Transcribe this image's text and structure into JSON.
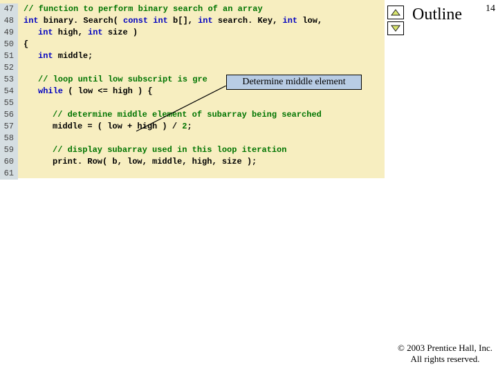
{
  "page_number": "14",
  "outline_title": "Outline",
  "callout_text": "Determine middle element",
  "footer_line1": "© 2003 Prentice Hall, Inc.",
  "footer_line2": "All rights reserved.",
  "code": {
    "lines": [
      {
        "n": "47",
        "indent": 0,
        "segs": [
          {
            "cls": "comment",
            "t": "// function to perform binary search of an array"
          }
        ]
      },
      {
        "n": "48",
        "indent": 0,
        "segs": [
          {
            "cls": "kw-blue",
            "t": "int"
          },
          {
            "cls": "code-text",
            "t": " binary. Search( "
          },
          {
            "cls": "kw-blue",
            "t": "const int"
          },
          {
            "cls": "code-text",
            "t": " b[], "
          },
          {
            "cls": "kw-blue",
            "t": "int"
          },
          {
            "cls": "code-text",
            "t": " search. Key, "
          },
          {
            "cls": "kw-blue",
            "t": "int"
          },
          {
            "cls": "code-text",
            "t": " low,"
          }
        ]
      },
      {
        "n": "49",
        "indent": 1,
        "segs": [
          {
            "cls": "kw-blue",
            "t": "int"
          },
          {
            "cls": "code-text",
            "t": " high, "
          },
          {
            "cls": "kw-blue",
            "t": "int"
          },
          {
            "cls": "code-text",
            "t": " size )"
          }
        ]
      },
      {
        "n": "50",
        "indent": 0,
        "segs": [
          {
            "cls": "code-text",
            "t": "{"
          }
        ]
      },
      {
        "n": "51",
        "indent": 1,
        "segs": [
          {
            "cls": "kw-blue",
            "t": "int"
          },
          {
            "cls": "code-text",
            "t": " middle;"
          }
        ]
      },
      {
        "n": "52",
        "indent": 0,
        "segs": []
      },
      {
        "n": "53",
        "indent": 1,
        "segs": [
          {
            "cls": "comment",
            "t": "// loop until low subscript is gre"
          }
        ]
      },
      {
        "n": "54",
        "indent": 1,
        "segs": [
          {
            "cls": "kw-blue",
            "t": "while"
          },
          {
            "cls": "code-text",
            "t": " ( low <= high ) {"
          }
        ]
      },
      {
        "n": "55",
        "indent": 0,
        "segs": []
      },
      {
        "n": "56",
        "indent": 2,
        "segs": [
          {
            "cls": "comment",
            "t": "// determine middle element of subarray being searched"
          }
        ]
      },
      {
        "n": "57",
        "indent": 2,
        "segs": [
          {
            "cls": "code-text",
            "t": "middle = ( low + high ) / "
          },
          {
            "cls": "num",
            "t": "2"
          },
          {
            "cls": "code-text",
            "t": ";"
          }
        ]
      },
      {
        "n": "58",
        "indent": 0,
        "segs": []
      },
      {
        "n": "59",
        "indent": 2,
        "segs": [
          {
            "cls": "comment",
            "t": "// display subarray used in this loop iteration"
          }
        ]
      },
      {
        "n": "60",
        "indent": 2,
        "segs": [
          {
            "cls": "code-text",
            "t": "print. Row( b, low, middle, high, size );"
          }
        ]
      },
      {
        "n": "61",
        "indent": 0,
        "segs": []
      }
    ]
  }
}
